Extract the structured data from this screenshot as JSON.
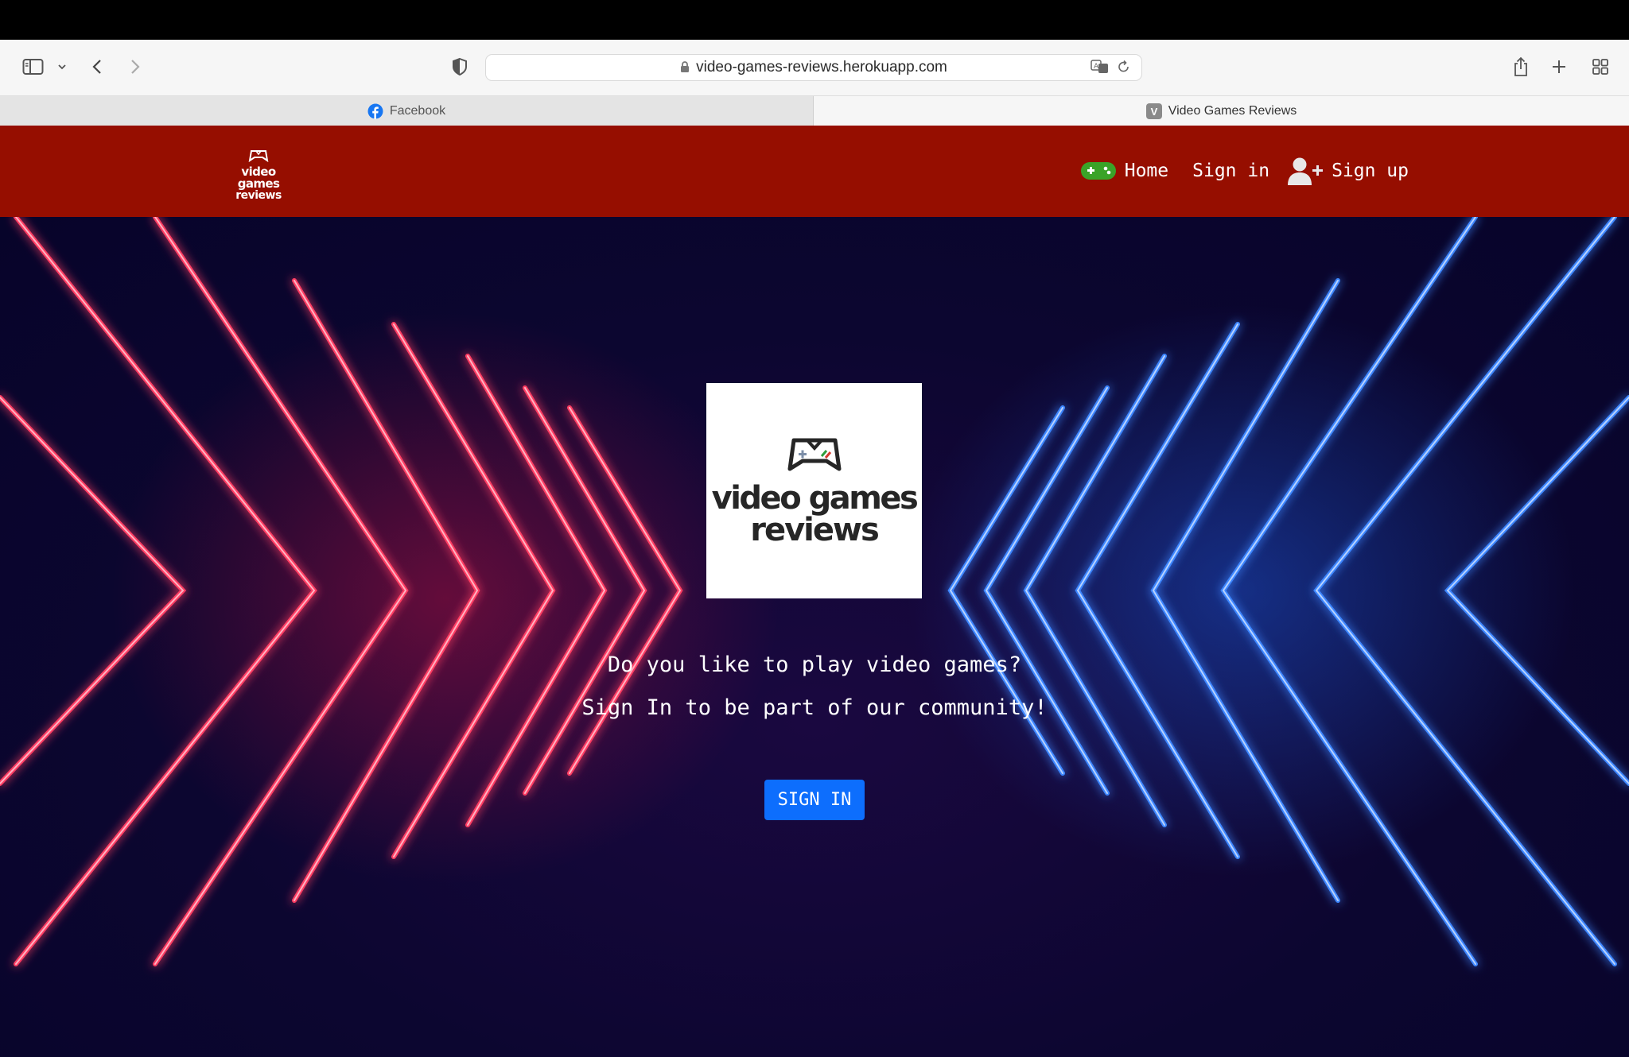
{
  "browser": {
    "url": "video-games-reviews.herokuapp.com",
    "tabs": [
      {
        "label": "Facebook",
        "active": false
      },
      {
        "label": "Video Games Reviews",
        "active": true
      }
    ],
    "active_tab_favicon_letter": "V"
  },
  "site": {
    "logo": {
      "line1": "video games",
      "line2": "reviews"
    },
    "nav": {
      "home": "Home",
      "signin": "Sign in",
      "signup": "Sign up"
    }
  },
  "hero": {
    "logo": {
      "line1": "video games",
      "line2": "reviews"
    },
    "question": "Do you like to play video games?",
    "invite": "Sign In to be part of our community!",
    "cta": "SIGN IN"
  },
  "colors": {
    "nav_bg": "#960e00",
    "cta_bg": "#0d6efd",
    "neon_red": "#ff2a55",
    "neon_blue": "#2f7bff",
    "gamepad_green": "#3aa328"
  }
}
